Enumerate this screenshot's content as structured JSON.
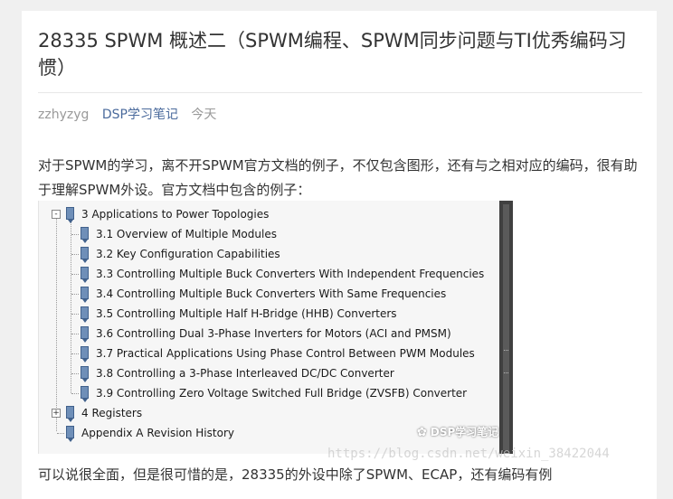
{
  "article": {
    "title": "28335 SPWM 概述二（SPWM编程、SPWM同步问题与TI优秀编码习惯）",
    "author": "zzhyzyg",
    "category": "DSP学习笔记",
    "time": "今天",
    "intro": "对于SPWM的学习，离不开SPWM官方文档的例子，不仅包含图形，还有与之相对应的编码，很有助于理解SPWM外设。官方文档中包含的例子：",
    "next_paragraph": "可以说很全面，但是很可惜的是，28335的外设中除了SPWM、ECAP，还有编码有例"
  },
  "tree": [
    {
      "label": "3  Applications to Power Topologies",
      "level": 0,
      "expander": "-"
    },
    {
      "label": "3.1  Overview of Multiple Modules",
      "level": 1
    },
    {
      "label": "3.2  Key Configuration Capabilities",
      "level": 1
    },
    {
      "label": "3.3  Controlling Multiple Buck Converters With Independent Frequencies",
      "level": 1
    },
    {
      "label": "3.4  Controlling Multiple Buck Converters With Same Frequencies",
      "level": 1
    },
    {
      "label": "3.5  Controlling Multiple Half H-Bridge (HHB) Converters",
      "level": 1
    },
    {
      "label": "3.6  Controlling Dual 3-Phase Inverters for Motors (ACI and PMSM)",
      "level": 1
    },
    {
      "label": "3.7  Practical Applications Using Phase Control Between PWM Modules",
      "level": 1
    },
    {
      "label": "3.8  Controlling a 3-Phase Interleaved DC/DC Converter",
      "level": 1
    },
    {
      "label": "3.9  Controlling Zero Voltage Switched Full Bridge (ZVSFB) Converter",
      "level": 1
    },
    {
      "label": "4  Registers",
      "level": 0,
      "expander": "+"
    },
    {
      "label": "Appendix A  Revision History",
      "level": 0
    }
  ],
  "watermark": {
    "logo_text": "DSP学习笔记",
    "url": "https://blog.csdn.net/weixin_38422044"
  }
}
